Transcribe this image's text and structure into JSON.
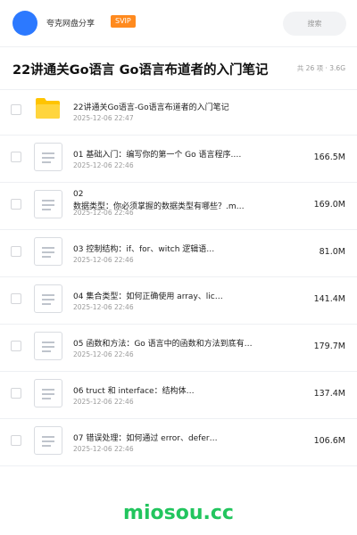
{
  "header": {
    "share_name": "夸克网盘分享",
    "badge": "SVIP",
    "search_label": "搜索",
    "accent_color": "#2c79ff",
    "badge_color": "#ff8a1e"
  },
  "folder_title": "22讲通关Go语言 Go语言布道者的入门笔记",
  "folder_meta": "共 26 项 · 3.6G",
  "files": [
    {
      "type": "folder",
      "name": "22讲通关Go语言-Go语言布道者的入门笔记",
      "date": "2025-12-06 22:47",
      "size": ""
    },
    {
      "type": "doc",
      "name": "01  基础入门：编写你的第一个 Go 语言程序.…",
      "date": "2025-12-06 22:46",
      "size": "166.5M"
    },
    {
      "type": "doc",
      "name": "02\n数据类型：你必须掌握的数据类型有哪些？.m…",
      "date": "2025-12-06 22:46",
      "size": "169.0M"
    },
    {
      "type": "doc",
      "name": "03  控制结构：if、for、witch 逻辑语…",
      "date": "2025-12-06 22:46",
      "size": "81.0M"
    },
    {
      "type": "doc",
      "name": "04  集合类型：如何正确使用 array、lic…",
      "date": "2025-12-06 22:46",
      "size": "141.4M"
    },
    {
      "type": "doc",
      "name": "05  函数和方法：Go 语言中的函数和方法到底有…",
      "date": "2025-12-06 22:46",
      "size": "179.7M"
    },
    {
      "type": "doc",
      "name": "06  truct 和 interface：结构体…",
      "date": "2025-12-06 22:46",
      "size": "137.4M"
    },
    {
      "type": "doc",
      "name": "07  错误处理：如何通过 error、defer…",
      "date": "2025-12-06 22:46",
      "size": "106.6M"
    }
  ],
  "watermark": "miosou.cc",
  "watermark_color": "#22c55e"
}
